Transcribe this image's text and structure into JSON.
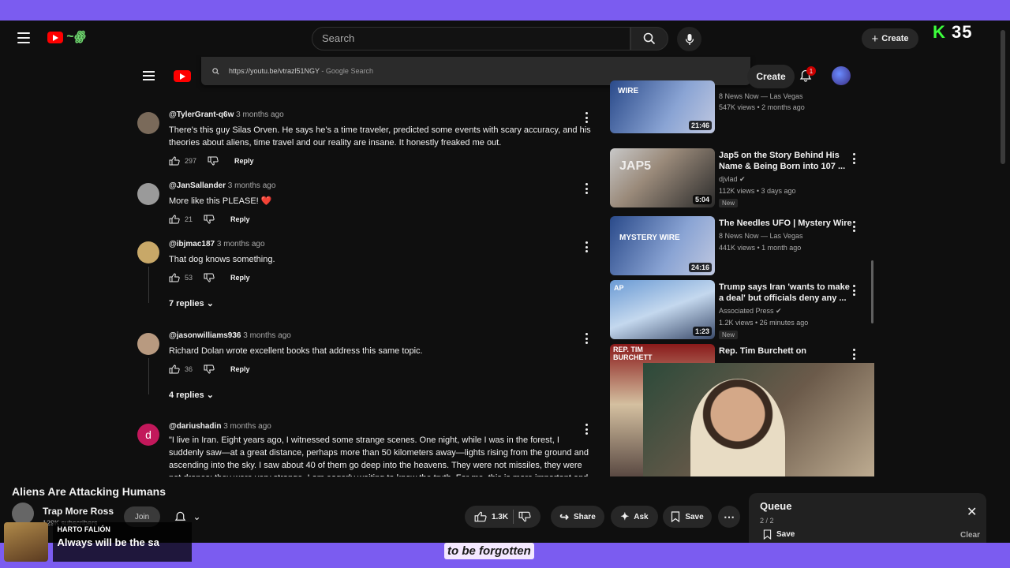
{
  "topbar": {
    "search_placeholder": "Search",
    "create_label": "Create",
    "kick_label": "K",
    "counter": "35"
  },
  "inner": {
    "url": "https://youtu.be/vtrazl51NGY",
    "url_suffix": "- Google Search",
    "create_label": "Create",
    "notif_count": "1"
  },
  "comments": [
    {
      "user": "@TylerGrant-q6w",
      "time": "3 months ago",
      "text": "There's this guy Silas Orven. He says he's a time traveler, predicted some events with scary accuracy, and his theories about aliens, time travel and our reality are insane. It honestly freaked me out.",
      "likes": "297",
      "reply": "Reply"
    },
    {
      "user": "@JanSallander",
      "time": "3 months ago",
      "text": "More like this PLEASE! ❤️",
      "likes": "21",
      "reply": "Reply"
    },
    {
      "user": "@ibjmac187",
      "time": "3 months ago",
      "text": "That dog knows something.",
      "likes": "53",
      "reply": "Reply",
      "replies": "7 replies"
    },
    {
      "user": "@jasonwilliams936",
      "time": "3 months ago",
      "text": "Richard Dolan wrote excellent books that address this same topic.",
      "likes": "36",
      "reply": "Reply",
      "replies": "4 replies"
    },
    {
      "user": "@dariushadin",
      "time": "3 months ago",
      "text": "\"I live in Iran. Eight years ago, I witnessed some strange scenes. One night, while I was in the forest, I suddenly saw—at a great distance, perhaps more than 50 kilometers away—lights rising from the ground and ascending into the sky. I saw about 40 of them go deep into the heavens. They were not missiles, they were not drones; they were very strange. I am eagerly waiting to know the truth. For me, this is more important and fascinating ..."
    }
  ],
  "videos": [
    {
      "title": "",
      "channel": "8 News Now — Las Vegas",
      "meta": "547K views • 2 months ago",
      "duration": "21:46",
      "thumb_text": "WIRE"
    },
    {
      "title": "Jap5 on the Story Behind His Name & Being Born into 107 ...",
      "channel": "djvlad",
      "meta": "112K views • 3 days ago",
      "duration": "5:04",
      "badge": "New",
      "thumb_text": "JAP5"
    },
    {
      "title": "The Needles UFO | Mystery Wire",
      "channel": "8 News Now — Las Vegas",
      "meta": "441K views • 1 month ago",
      "duration": "24:16",
      "thumb_text": "MYSTERY WIRE"
    },
    {
      "title": "Trump says Iran 'wants to make a deal' but officials deny any ...",
      "channel": "Associated Press",
      "meta": "1.2K views • 26 minutes ago",
      "duration": "1:23",
      "badge": "New",
      "thumb_text": "AP"
    },
    {
      "title": "Rep. Tim Burchett on",
      "thumb_text": "REP. TIM BURCHETT"
    }
  ],
  "player": {
    "title": "Aliens Are Attacking Humans",
    "channel": "Trap More Ross",
    "subs": "129K subscribers",
    "join": "Join",
    "likes": "1.3K",
    "share": "Share",
    "ask": "Ask",
    "save": "Save"
  },
  "queue": {
    "title": "Queue",
    "count": "2 / 2",
    "save": "Save",
    "clear": "Clear"
  },
  "overlay": {
    "chatter_name": "HARTO FALIÓN",
    "chatter_msg": "Always will be the sa",
    "caption": "to be forgotten"
  },
  "colors": {
    "accent_purple": "#7b5cf0",
    "yt_red": "#ff0000",
    "kick_green": "#3cff3c"
  }
}
